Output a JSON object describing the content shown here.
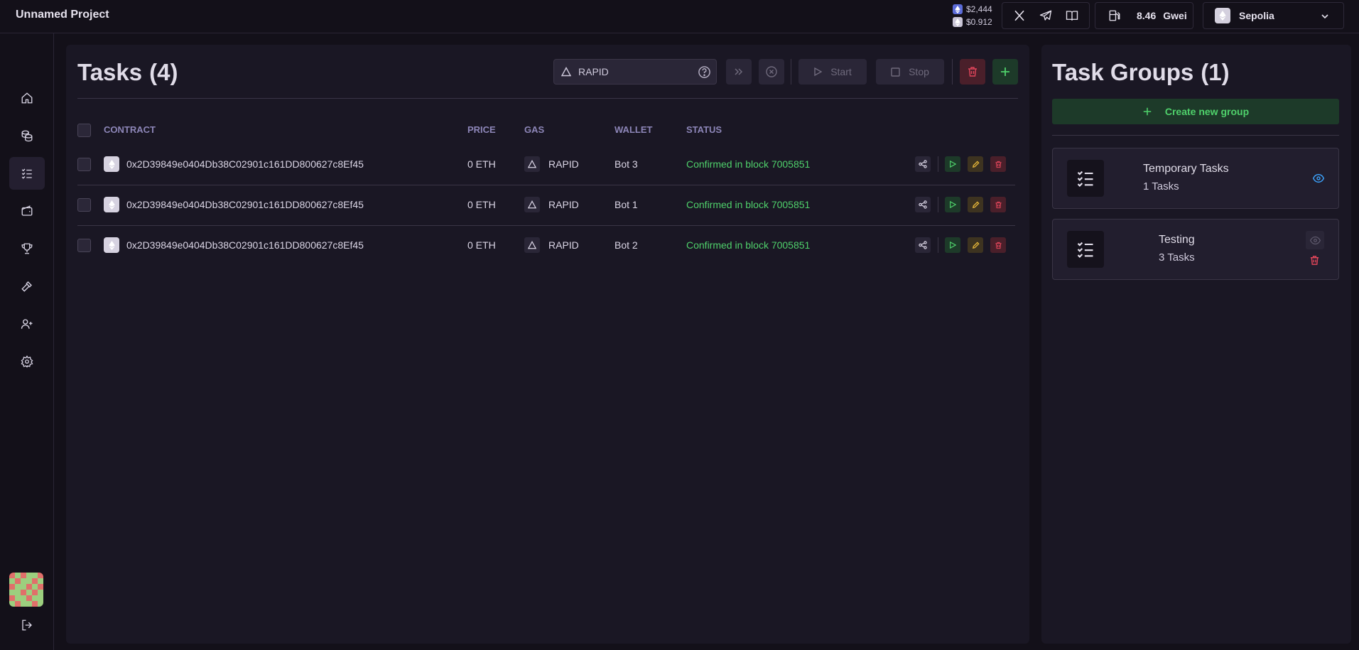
{
  "app": {
    "title": "Unnamed Project"
  },
  "prices": {
    "eth": "$2,444",
    "op": "$0.912"
  },
  "gas": {
    "value": "8.46",
    "unit": "Gwei"
  },
  "network": {
    "name": "Sepolia"
  },
  "tasks": {
    "title": "Tasks",
    "count": "(4)",
    "filter_value": "RAPID",
    "start_label": "Start",
    "stop_label": "Stop",
    "columns": {
      "contract": "CONTRACT",
      "price": "PRICE",
      "gas": "GAS",
      "wallet": "WALLET",
      "status": "STATUS"
    },
    "rows": [
      {
        "contract": "0x2D39849e0404Db38C02901c161DD800627c8Ef45",
        "price": "0 ETH",
        "gas": "RAPID",
        "wallet": "Bot 3",
        "status": "Confirmed in block 7005851"
      },
      {
        "contract": "0x2D39849e0404Db38C02901c161DD800627c8Ef45",
        "price": "0 ETH",
        "gas": "RAPID",
        "wallet": "Bot 1",
        "status": "Confirmed in block 7005851"
      },
      {
        "contract": "0x2D39849e0404Db38C02901c161DD800627c8Ef45",
        "price": "0 ETH",
        "gas": "RAPID",
        "wallet": "Bot 2",
        "status": "Confirmed in block 7005851"
      }
    ]
  },
  "groups": {
    "title": "Task Groups",
    "count": "(1)",
    "create_label": "Create new group",
    "items": [
      {
        "name": "Temporary Tasks",
        "count": "1 Tasks"
      },
      {
        "name": "Testing",
        "count": "3 Tasks"
      }
    ]
  },
  "colors": {
    "accent_green": "#4fd16b",
    "accent_blue": "#3b9ef5",
    "danger": "#e0455a",
    "warning": "#e8b83a"
  },
  "icons": [
    "home-icon",
    "coins-icon",
    "tasks-icon",
    "wallet-icon",
    "trophy-icon",
    "hammer-icon",
    "user-plus-icon",
    "settings-icon",
    "logout-icon",
    "x-twitter-icon",
    "telegram-icon",
    "book-icon",
    "gas-pump-icon",
    "ethereum-icon"
  ]
}
